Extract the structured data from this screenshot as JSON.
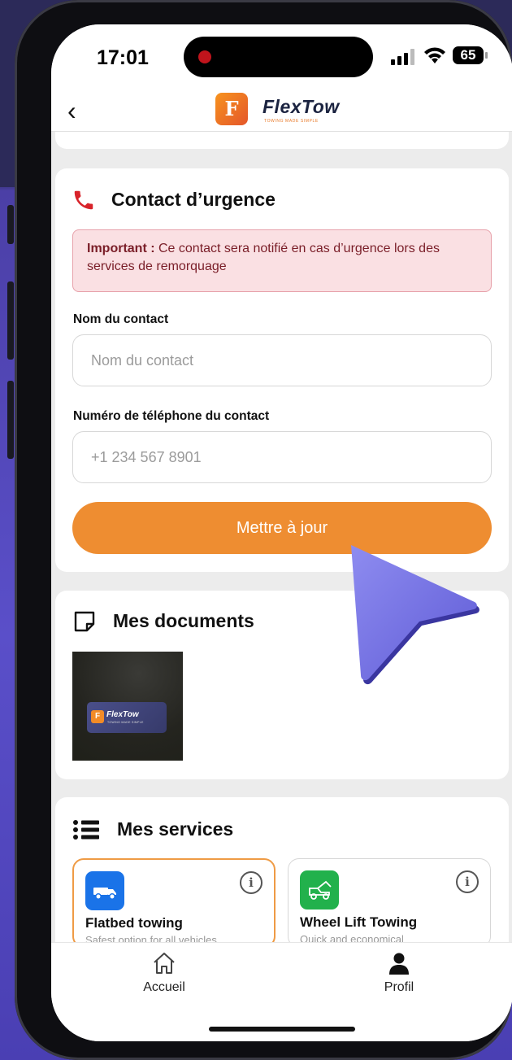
{
  "status_bar": {
    "time": "17:01",
    "battery": "65"
  },
  "header": {
    "back_label": "‹",
    "logo_letter": "F",
    "app_name": "FlexTow",
    "tagline": "TOWING MADE SIMPLE"
  },
  "emergency_contact": {
    "title": "Contact d’urgence",
    "alert_strong": "Important :",
    "alert_text": " Ce contact sera notifié en cas d’urgence lors des services de remorquage",
    "name_label": "Nom du contact",
    "name_placeholder": "Nom du contact",
    "name_value": "",
    "phone_label": "Numéro de téléphone du contact",
    "phone_placeholder": "+1 234 567 8901",
    "phone_value": "",
    "update_button": "Mettre à jour"
  },
  "documents": {
    "title": "Mes documents",
    "thumb_logo_letter": "F",
    "thumb_app_name": "FlexTow",
    "thumb_tagline": "TOWING MADE SIMPLE"
  },
  "services": {
    "title": "Mes services",
    "items": [
      {
        "name": "Flatbed towing",
        "description": "Safest option for all vehicles",
        "icon": "truck-icon",
        "icon_color": "#1a73e8",
        "selected": true
      },
      {
        "name": "Wheel Lift Towing",
        "description": "Quick and economical",
        "icon": "tow-truck-icon",
        "icon_color": "#22b14c",
        "selected": false
      }
    ],
    "info_glyph": "i"
  },
  "tab_bar": {
    "items": [
      {
        "label": "Accueil",
        "icon": "home-icon"
      },
      {
        "label": "Profil",
        "icon": "profile-icon"
      }
    ]
  },
  "colors": {
    "accent": "#ee8d31",
    "alert_bg": "#fae0e3",
    "alert_text": "#7a1e28",
    "phone_icon": "#d8232a"
  }
}
